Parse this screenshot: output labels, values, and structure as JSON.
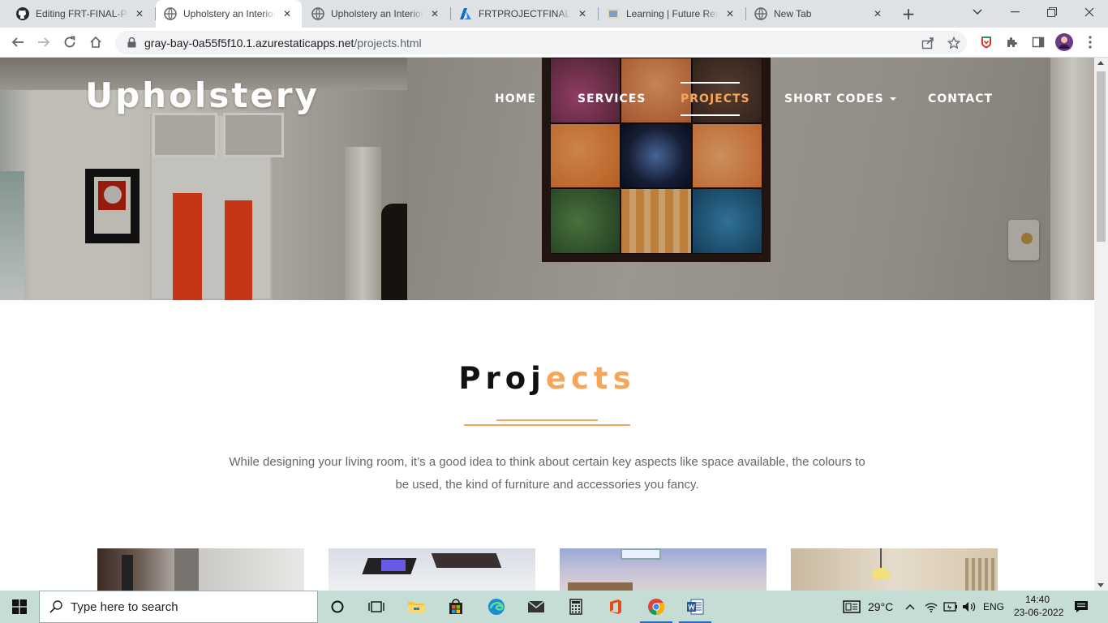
{
  "browser": {
    "tabs": [
      {
        "title": "Editing FRT-FINAL-PR",
        "favicon": "github-icon",
        "active": false
      },
      {
        "title": "Upholstery an Interior",
        "favicon": "globe-icon",
        "active": true
      },
      {
        "title": "Upholstery an Interior",
        "favicon": "globe-icon",
        "active": false
      },
      {
        "title": "FRTPROJECTFINAL - M",
        "favicon": "azure-icon",
        "active": false
      },
      {
        "title": "Learning | Future Reac",
        "favicon": "learning-icon",
        "active": false
      },
      {
        "title": "New Tab",
        "favicon": "globe-icon",
        "active": false
      }
    ],
    "url_host": "gray-bay-0a55f5f10.1.azurestaticapps.net",
    "url_path": "/projects.html"
  },
  "site": {
    "brand": "Upholstery",
    "nav": [
      {
        "label": "HOME",
        "active": false
      },
      {
        "label": "SERVICES",
        "active": false
      },
      {
        "label": "PROJECTS",
        "active": true
      },
      {
        "label": "SHORT CODES",
        "active": false,
        "dropdown": true
      },
      {
        "label": "CONTACT",
        "active": false
      }
    ],
    "section_title_dark": "Proj",
    "section_title_accent": "ects",
    "description": "While designing your living room, it’s a good idea to think about certain key aspects like space available, the colours to be used, the kind of furniture and accessories you fancy.",
    "accent_color": "#f6a65a"
  },
  "taskbar": {
    "search_placeholder": "Type here to search",
    "weather": "29°C",
    "language": "ENG",
    "time": "14:40",
    "date": "23-06-2022"
  }
}
